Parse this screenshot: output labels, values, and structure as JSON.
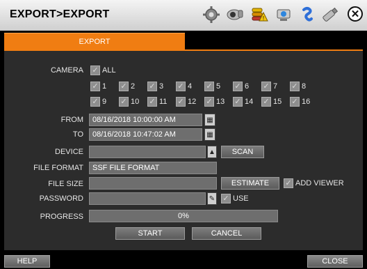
{
  "window": {
    "title": "EXPORT>EXPORT"
  },
  "toolbar": {
    "icons": [
      "settings-gear-icon",
      "camera-icon",
      "storage-alert-icon",
      "network-icon",
      "user-icon",
      "usb-icon"
    ]
  },
  "tabs": [
    {
      "label": "EXPORT",
      "active": true
    }
  ],
  "form": {
    "camera_label": "CAMERA",
    "all_label": "ALL",
    "cameras": [
      "1",
      "2",
      "3",
      "4",
      "5",
      "6",
      "7",
      "8",
      "9",
      "10",
      "11",
      "12",
      "13",
      "14",
      "15",
      "16"
    ],
    "from_label": "FROM",
    "from_value": "08/16/2018 10:00:00 AM",
    "to_label": "TO",
    "to_value": "08/16/2018 10:47:02 AM",
    "device_label": "DEVICE",
    "device_value": "",
    "scan_label": "SCAN",
    "file_format_label": "FILE FORMAT",
    "file_format_value": "SSF FILE FORMAT",
    "file_size_label": "FILE SIZE",
    "file_size_value": "",
    "estimate_label": "ESTIMATE",
    "add_viewer_label": "ADD VIEWER",
    "password_label": "PASSWORD",
    "password_value": "",
    "use_label": "USE",
    "progress_label": "PROGRESS",
    "progress_text": "0%",
    "progress_value": 0,
    "start_label": "START",
    "cancel_label": "CANCEL"
  },
  "footer": {
    "help_label": "HELP",
    "close_label": "CLOSE"
  },
  "colors": {
    "accent": "#f07d12",
    "panel": "#2c2c2c",
    "field": "#6e6e6e"
  }
}
